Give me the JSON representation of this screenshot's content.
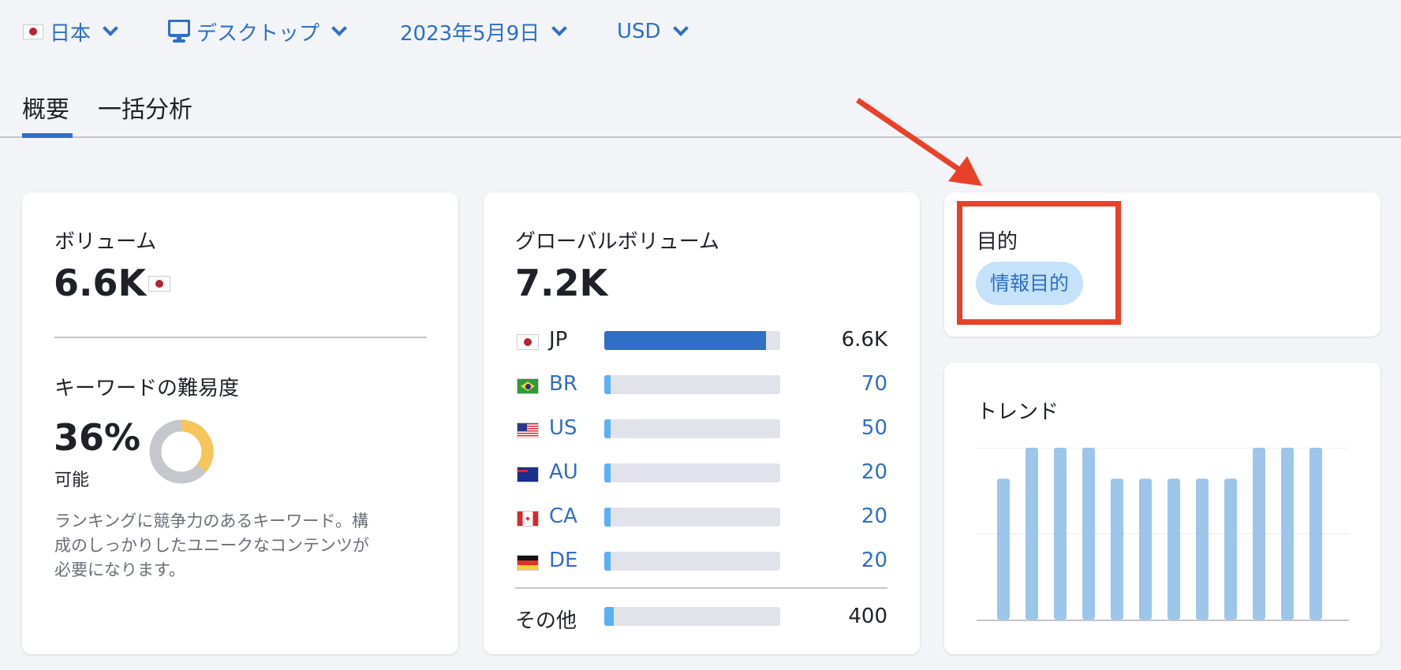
{
  "topbar": {
    "country": {
      "label": "日本",
      "icon": "flag-jp-icon"
    },
    "device": {
      "label": "デスクトップ",
      "icon": "desktop-icon"
    },
    "date": {
      "label": "2023年5月9日"
    },
    "currency": {
      "label": "USD"
    }
  },
  "tabs": [
    {
      "label": "概要",
      "active": true
    },
    {
      "label": "一括分析",
      "active": false
    }
  ],
  "volume": {
    "title": "ボリューム",
    "value": "6.6K"
  },
  "difficulty": {
    "title": "キーワードの難易度",
    "value": "36%",
    "percent": 36,
    "level": "可能",
    "description": [
      "ランキングに競争力のあるキーワード。構",
      "成のしっかりしたユニークなコンテンツが",
      "必要になります。"
    ],
    "colors": {
      "filled": "#f6c55b",
      "empty": "#c5c7cd"
    }
  },
  "global_volume": {
    "title": "グローバルボリューム",
    "value": "7.2K",
    "rows": [
      {
        "code": "JP",
        "value": "6.6K",
        "fraction": 0.92
      },
      {
        "code": "BR",
        "value": "70",
        "fraction": 0.01
      },
      {
        "code": "US",
        "value": "50",
        "fraction": 0.01
      },
      {
        "code": "AU",
        "value": "20",
        "fraction": 0.01
      },
      {
        "code": "CA",
        "value": "20",
        "fraction": 0.01
      },
      {
        "code": "DE",
        "value": "20",
        "fraction": 0.01
      }
    ],
    "other": {
      "label": "その他",
      "value": "400",
      "fraction": 0.055
    }
  },
  "intent": {
    "title": "目的",
    "badge": "情報目的"
  },
  "trend": {
    "title": "トレンド"
  },
  "chart_data": {
    "type": "bar",
    "title": "トレンド",
    "values": [
      0.82,
      1,
      1,
      1,
      0.82,
      0.82,
      0.82,
      0.82,
      0.82,
      1,
      1,
      1
    ],
    "ylim": [
      0,
      1
    ],
    "grid": true,
    "color": "#9dc5ea"
  },
  "annotation": {
    "color": "#e8412a"
  }
}
